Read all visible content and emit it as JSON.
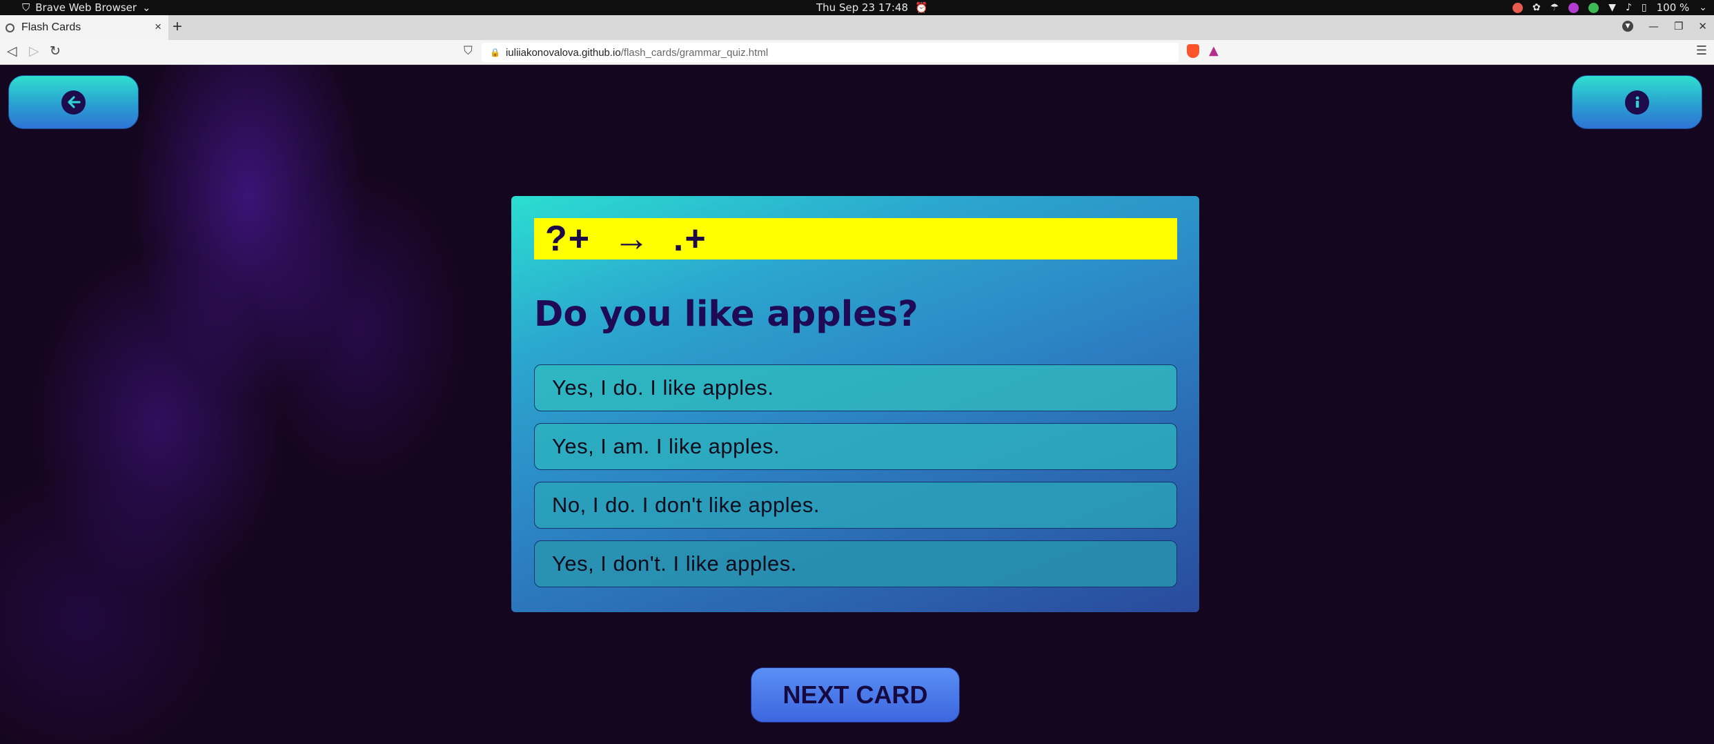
{
  "system_bar": {
    "app_name": "Brave Web Browser",
    "app_caret": "⌄",
    "clock": "Thu Sep 23  17:48",
    "battery": "100 %",
    "tray_colors": [
      "#e85b4e",
      "#d94d5c",
      "#b23bd1",
      "#3cba54"
    ]
  },
  "browser": {
    "tab_title": "Flash Cards",
    "tab_close": "×",
    "new_tab": "+",
    "url_host": "iuliiakonovalova.github.io",
    "url_path": "/flash_cards/grammar_quiz.html"
  },
  "page": {
    "back_icon": "arrow-left-icon",
    "info_icon": "info-icon",
    "formula": "?+  →  .+",
    "question": "Do you like apples?",
    "options": [
      "Yes, I do. I like apples.",
      "Yes, I am. I like apples.",
      "No, I do. I don't like apples.",
      "Yes, I don't. I like apples."
    ],
    "next_label": "NEXT CARD"
  },
  "colors": {
    "formula_bg": "#ffff00",
    "question_text": "#1e0a55",
    "next_button": "#4a7be8"
  }
}
